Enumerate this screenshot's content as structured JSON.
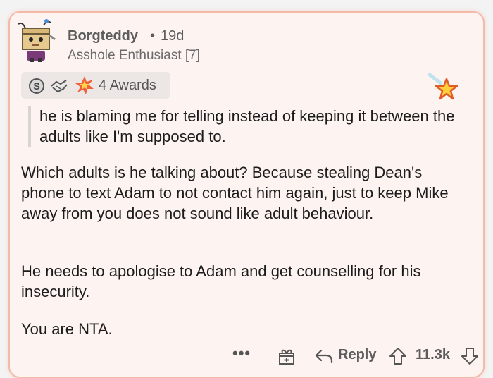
{
  "comment": {
    "author": "Borgteddy",
    "separator": "•",
    "age": "19d",
    "flair": "Asshole Enthusiast [7]",
    "awards": {
      "icons": [
        "silver-coin-icon",
        "handshake-icon",
        "starburst-icon"
      ],
      "count_label": "4 Awards"
    },
    "corner_award_icon": "star-icon",
    "quote": "he is blaming me for telling instead of keeping it between the adults like I'm supposed to.",
    "paragraphs": [
      "Which adults is he talking about? Because stealing Dean's phone to text Adam to not contact him again, just to keep Mike away from you does not sound like adult behaviour.",
      "He needs to apologise to Adam and get counselling for his insecurity.",
      "You are NTA."
    ],
    "actions": {
      "more_label": "•••",
      "reply_label": "Reply",
      "score": "11.3k"
    }
  },
  "colors": {
    "card_background": "#fdf3f1",
    "card_border": "#f4b9a9",
    "meta_text": "#5c5c5c"
  }
}
